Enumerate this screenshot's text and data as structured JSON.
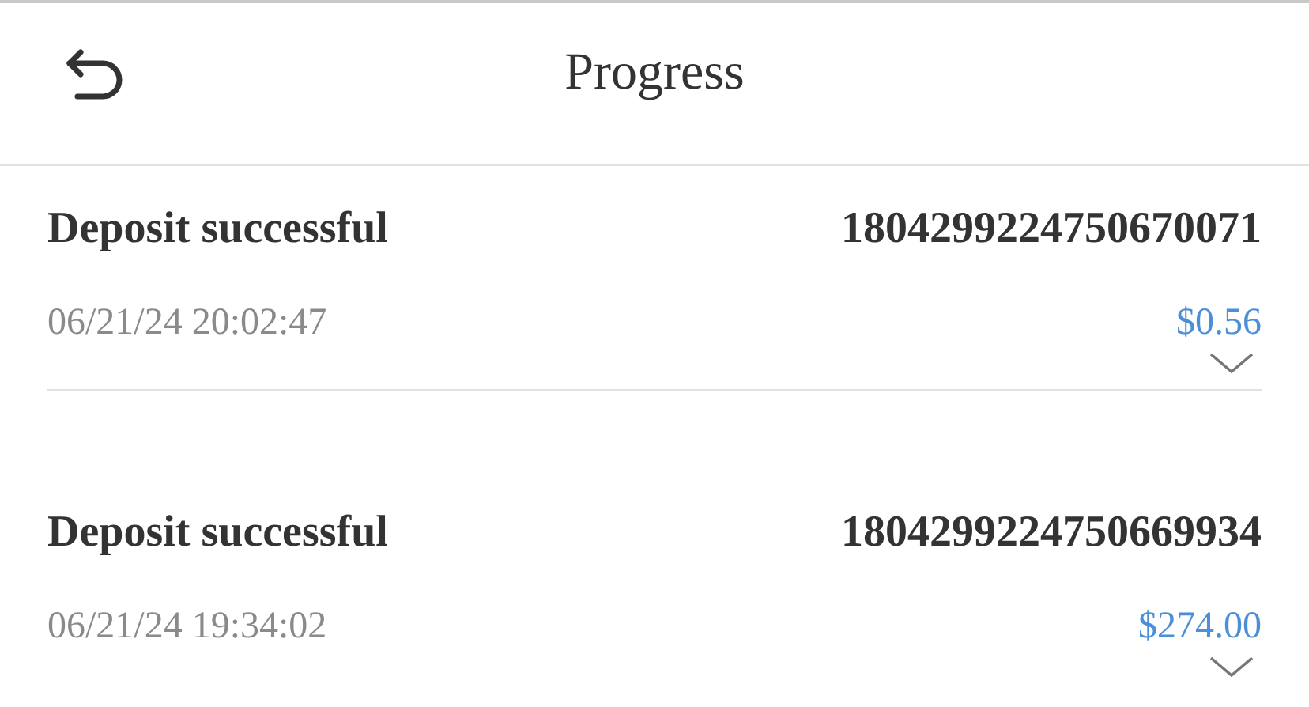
{
  "header": {
    "title": "Progress"
  },
  "transactions": [
    {
      "status": "Deposit successful",
      "id": "1804299224750670071",
      "date": "06/21/24 20:02:47",
      "amount": "$0.56",
      "expanded": false
    },
    {
      "status": "Deposit successful",
      "id": "1804299224750669934",
      "date": "06/21/24 19:34:02",
      "amount": "$274.00",
      "expanded": false
    }
  ]
}
